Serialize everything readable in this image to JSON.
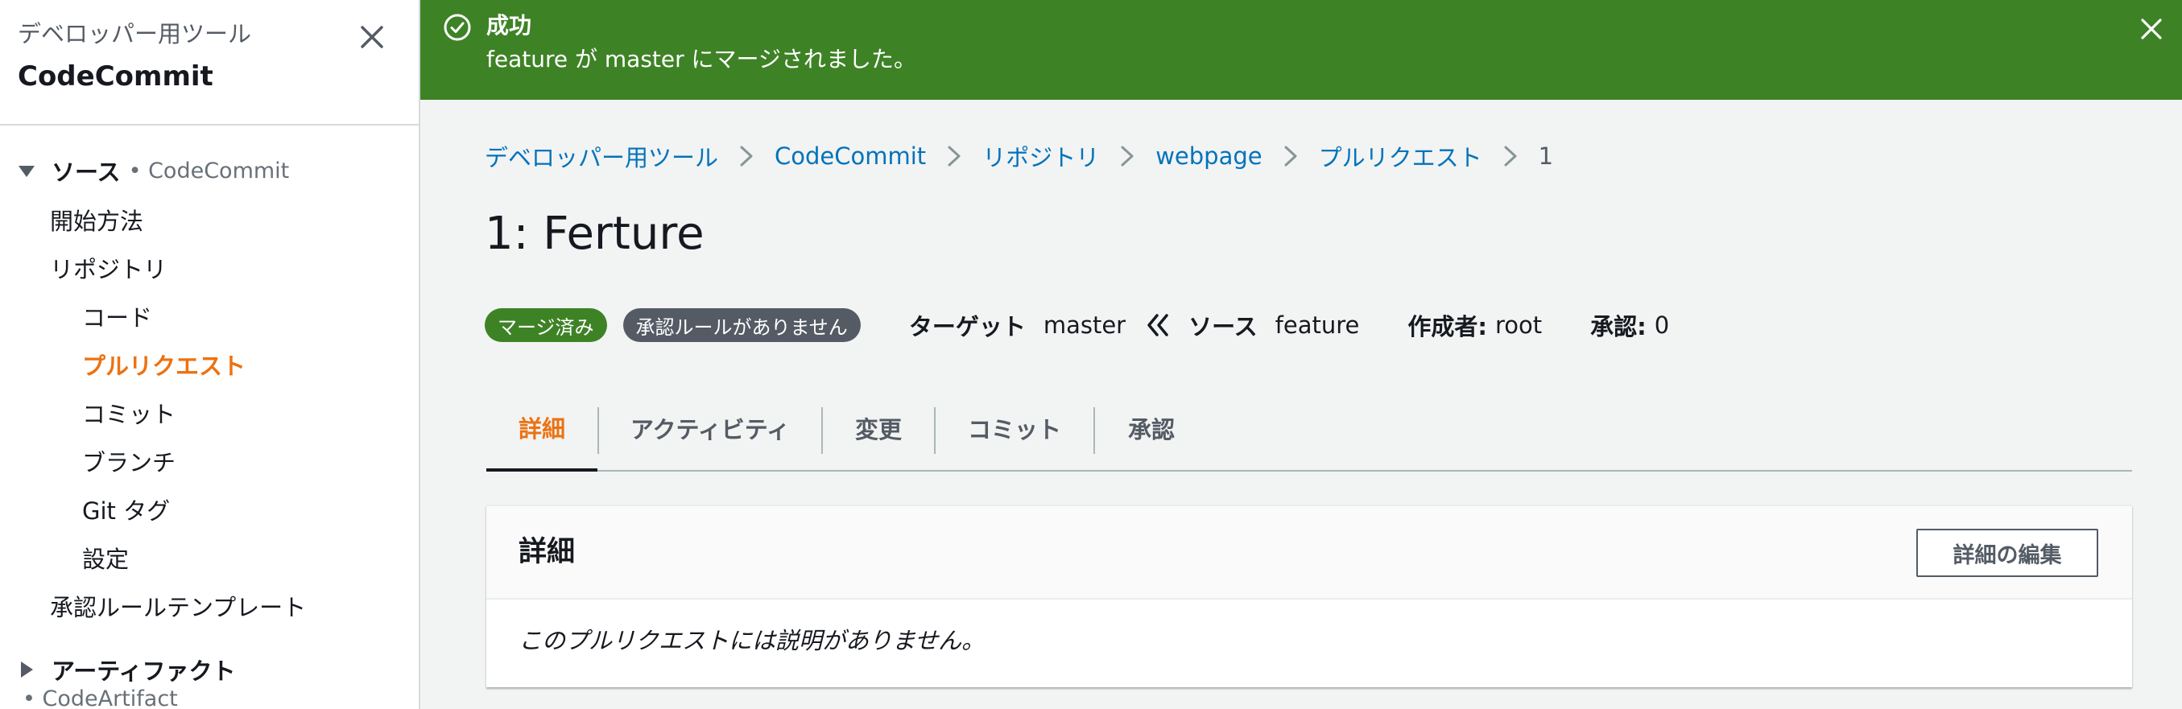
{
  "sidebar": {
    "supertitle": "デベロッパー用ツール",
    "title": "CodeCommit",
    "source_section": {
      "label": "ソース",
      "sub": "• CodeCommit"
    },
    "items": {
      "getting_started": "開始方法",
      "repositories": "リポジトリ",
      "code": "コード",
      "pull_requests": "プルリクエスト",
      "commits": "コミット",
      "branches": "ブランチ",
      "git_tags": "Git タグ",
      "settings": "設定",
      "approval_templates": "承認ルールテンプレート"
    },
    "artifact_section": {
      "label": "アーティファクト",
      "sub": "• CodeArtifact"
    }
  },
  "flash": {
    "title": "成功",
    "message": "feature が master にマージされました。",
    "color": "#3e8226"
  },
  "breadcrumb": {
    "items": [
      "デベロッパー用ツール",
      "CodeCommit",
      "リポジトリ",
      "webpage",
      "プルリクエスト"
    ],
    "current": "1"
  },
  "page": {
    "title": "1: Ferture"
  },
  "meta": {
    "status_badge": "マージ済み",
    "rule_badge": "承認ルールがありません",
    "target_label": "ターゲット",
    "target_value": "master",
    "source_label": "ソース",
    "source_value": "feature",
    "author_label": "作成者:",
    "author_value": "root",
    "approvals_label": "承認:",
    "approvals_value": "0"
  },
  "tabs": [
    "詳細",
    "アクティビティ",
    "変更",
    "コミット",
    "承認"
  ],
  "details": {
    "title": "詳細",
    "edit_button": "詳細の編集",
    "body": "このプルリクエストには説明がありません。"
  },
  "colors": {
    "accent": "#ec7211",
    "link": "#0073bb",
    "success": "#3e8226",
    "badge_gray": "#545b64"
  },
  "icons": {
    "sidebar_close": "close-icon",
    "flash_status": "check-circle-icon",
    "flash_close": "close-icon",
    "breadcrumb_separator": "chevron-right-icon",
    "merge_direction": "double-chevron-left-icon",
    "section_expanded": "caret-down-icon",
    "section_collapsed": "caret-right-icon"
  }
}
